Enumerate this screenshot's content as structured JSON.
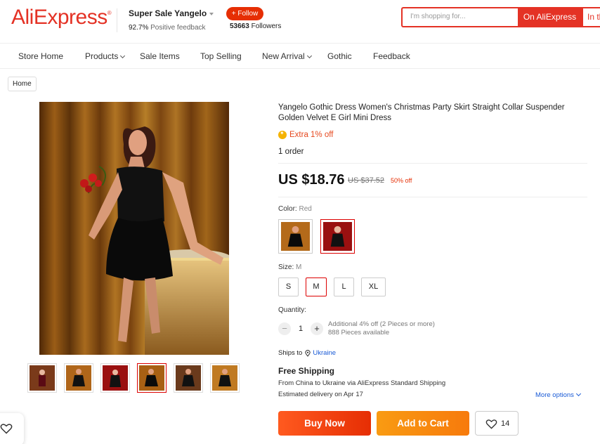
{
  "header": {
    "logo": "AliExpress",
    "logo_tm": "®",
    "store_name": "Super Sale Yangelo",
    "feedback_pct": "92.7%",
    "feedback_label": "Positive feedback",
    "follow_label": "+ Follow",
    "followers_count": "53663",
    "followers_label": "Followers",
    "search_placeholder": "I'm shopping for...",
    "search_on_ali": "On AliExpress",
    "search_in_store": "In this store"
  },
  "nav": {
    "items": [
      {
        "label": "Store Home"
      },
      {
        "label": "Products"
      },
      {
        "label": "Sale Items"
      },
      {
        "label": "Top Selling"
      },
      {
        "label": "New Arrival"
      },
      {
        "label": "Gothic"
      },
      {
        "label": "Feedback"
      }
    ]
  },
  "breadcrumb": "Home",
  "product": {
    "title": "Yangelo Gothic Dress Women's Christmas Party Skirt Straight Collar Suspender Golden Velvet E Girl Mini Dress",
    "extra_off": "Extra 1% off",
    "orders": "1 order",
    "price": "US $18.76",
    "old_price": "US $37.52",
    "discount": "50% off",
    "color_label": "Color:",
    "color_value": "Red",
    "size_label": "Size:",
    "size_value": "M",
    "sizes": [
      "S",
      "M",
      "L",
      "XL"
    ],
    "selected_size": "M",
    "quantity_label": "Quantity:",
    "quantity_minus": "−",
    "quantity_plus": "+",
    "quantity": "1",
    "quantity_note": "Additional 4% off (2 Pieces or more)",
    "available": "888 Pieces available"
  },
  "shipping": {
    "ships_to_label": "Ships to",
    "country": "Ukraine",
    "free_shipping": "Free Shipping",
    "route": "From China to Ukraine via AliExpress Standard Shipping",
    "estimated": "Estimated delivery on Apr 17",
    "more_options": "More options"
  },
  "actions": {
    "buy_now": "Buy Now",
    "add_to_cart": "Add to Cart",
    "wishlist_count": "14"
  },
  "colors": {
    "brand": "#e43225",
    "buy_now": "#e62e04",
    "add_to_cart": "#f78a0e",
    "link": "#1a5bd6"
  }
}
